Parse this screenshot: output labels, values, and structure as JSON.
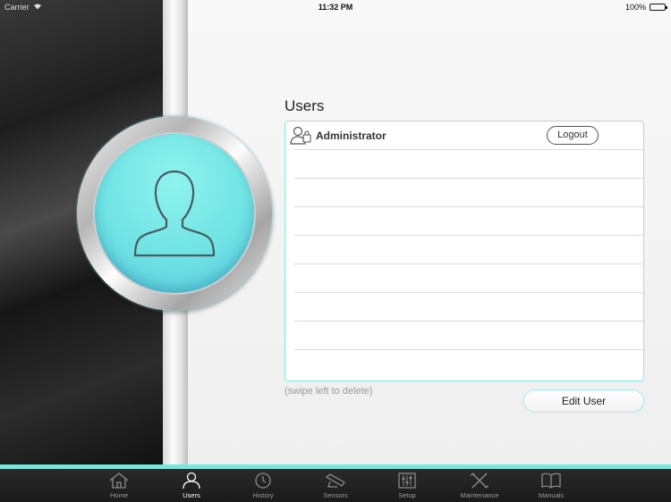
{
  "status_bar": {
    "carrier": "Carrier",
    "time": "11:32 PM",
    "battery": "100%",
    "battery_level": 1.0
  },
  "users_panel": {
    "title": "Users",
    "users": [
      {
        "name": "Administrator",
        "action_label": "Logout"
      }
    ],
    "swipe_hint": "(swipe left to delete)",
    "edit_button_label": "Edit User"
  },
  "accent_color": "#7fe3dd",
  "tabs": [
    {
      "label": "Home",
      "icon": "home-icon",
      "active": false
    },
    {
      "label": "Users",
      "icon": "user-icon",
      "active": true
    },
    {
      "label": "History",
      "icon": "clock-icon",
      "active": false
    },
    {
      "label": "Sensors",
      "icon": "sensor-icon",
      "active": false
    },
    {
      "label": "Setup",
      "icon": "sliders-icon",
      "active": false
    },
    {
      "label": "Maintenance",
      "icon": "tools-icon",
      "active": false
    },
    {
      "label": "Manuals",
      "icon": "book-icon",
      "active": false
    }
  ]
}
